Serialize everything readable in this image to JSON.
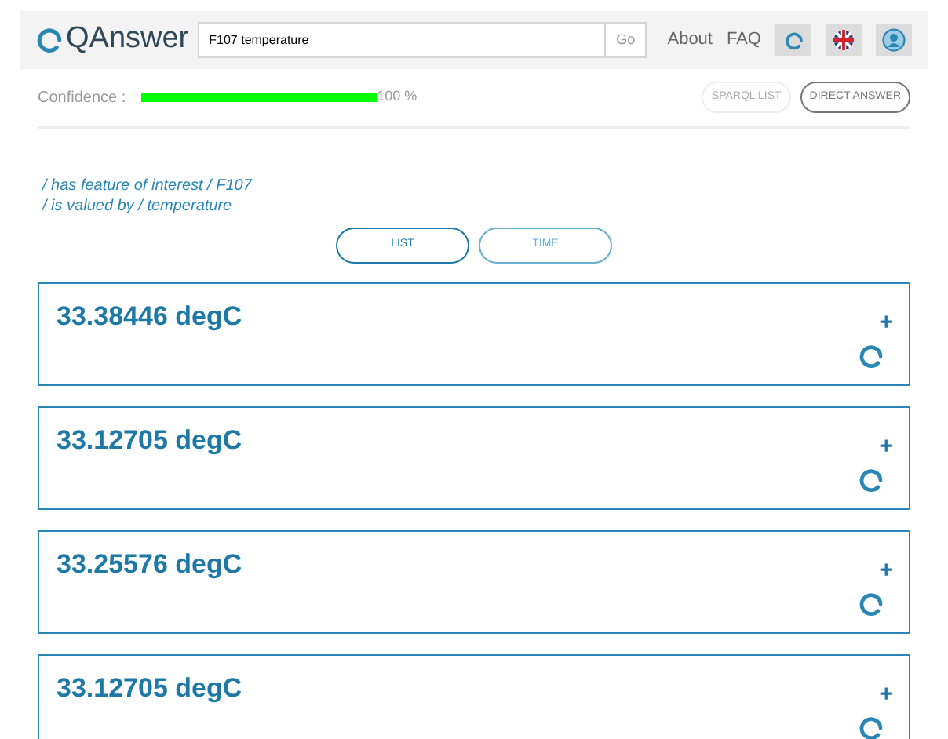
{
  "header": {
    "logo": "QAnswer",
    "search": {
      "value": "F107 temperature"
    },
    "go_button": "Go",
    "nav": [
      "About",
      "FAQ"
    ]
  },
  "confidence": {
    "label": "Confidence :",
    "level": 1,
    "reading": "100 %"
  },
  "view_buttons": [
    {
      "label": "SPARQL LIST",
      "selected": false
    },
    {
      "label": "DIRECT ANSWER",
      "selected": true
    }
  ],
  "query_path": [
    "/ has feature of interest / F107",
    "/ is valued by / temperature"
  ],
  "tabs": [
    {
      "label": "LIST",
      "selected": true
    },
    {
      "label": "TIME",
      "selected": false
    }
  ],
  "results": [
    {
      "value": "33.38446 degC",
      "expand": "+"
    },
    {
      "value": "33.12705 degC",
      "expand": "+"
    },
    {
      "value": "33.25576 degC",
      "expand": "+"
    },
    {
      "value": "33.12705 degC",
      "expand": "+"
    }
  ]
}
